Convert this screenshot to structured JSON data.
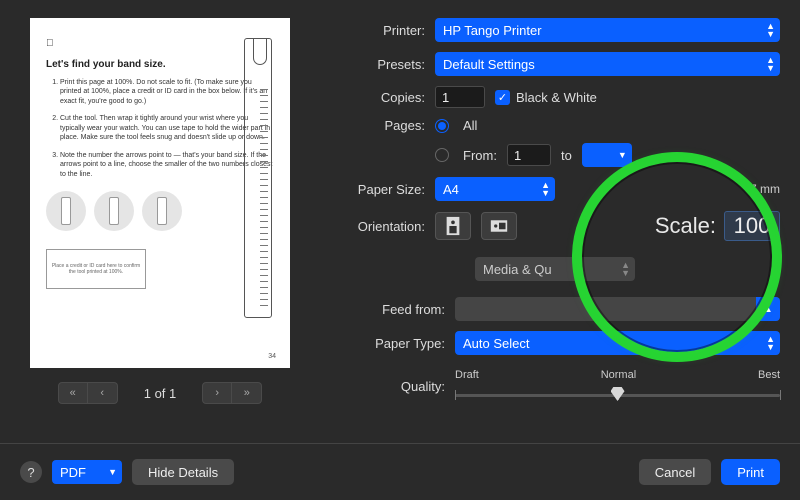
{
  "labels": {
    "printer": "Printer:",
    "presets": "Presets:",
    "copies": "Copies:",
    "bw": "Black & White",
    "pages": "Pages:",
    "all": "All",
    "from": "From:",
    "to": "to",
    "paper_size": "Paper Size:",
    "size_note": "7 mm",
    "orientation": "Orientation:",
    "scale": "Scale:",
    "section": "Media & Qu",
    "feed_from": "Feed from:",
    "paper_type": "Paper Type:",
    "quality": "Quality:",
    "quality_marks": {
      "draft": "Draft",
      "normal": "Normal",
      "best": "Best"
    }
  },
  "values": {
    "printer": "HP Tango Printer",
    "presets": "Default Settings",
    "copies": "1",
    "bw_checked": true,
    "pages_mode": "all",
    "from": "1",
    "to": "",
    "paper_size": "A4",
    "scale": "100",
    "feed_from": "",
    "paper_type": "Auto Select",
    "quality_index": 1
  },
  "pager": {
    "text": "1 of 1"
  },
  "footer": {
    "pdf": "PDF",
    "hide_details": "Hide Details",
    "cancel": "Cancel",
    "print": "Print"
  },
  "preview": {
    "heading": "Let's find your band size.",
    "step1": "Print this page at 100%. Do not scale to fit. (To make sure you printed at 100%, place a credit or ID card in the box below. If it's an exact fit, you're good to go.)",
    "step2": "Cut the tool. Then wrap it tightly around your wrist where you typically wear your watch. You can use tape to hold the wider part in place. Make sure the tool feels snug and doesn't slide up or down.",
    "step3": "Note the number the arrows point to — that's your band size. If the arrows point to a line, choose the smaller of the two numbers closest to the line.",
    "card": "Place a credit or ID card here to confirm the tool printed at 100%.",
    "page_number": "34"
  }
}
